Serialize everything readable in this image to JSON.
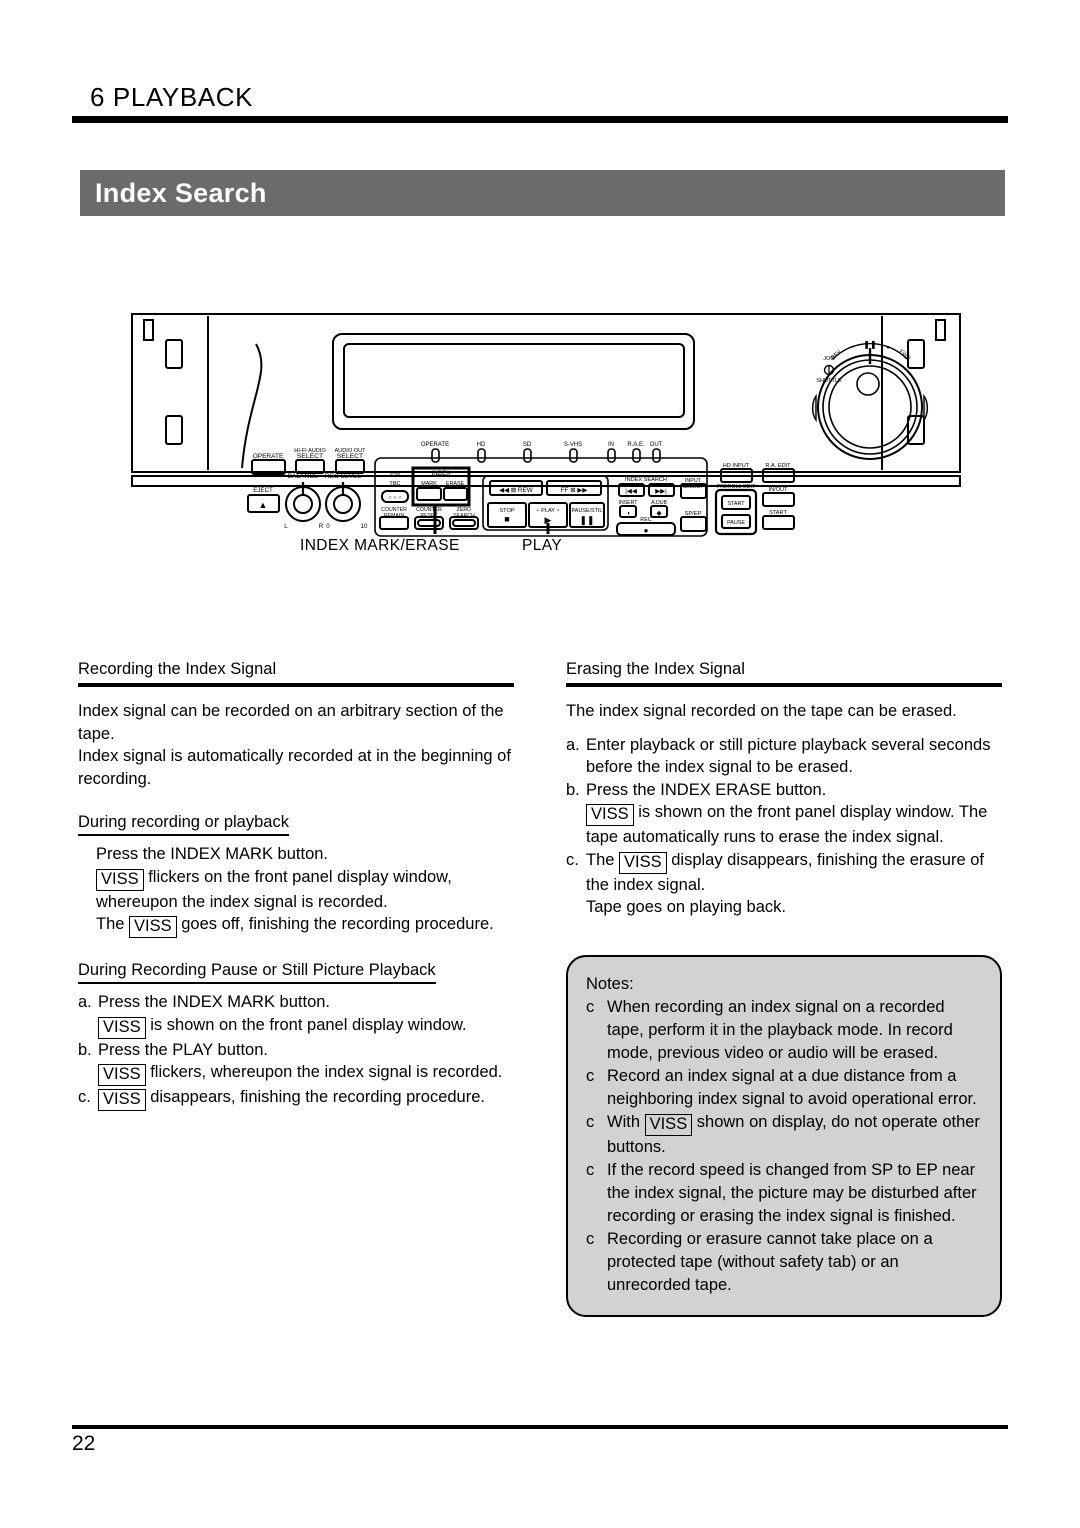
{
  "header": {
    "chapter_title": "6 PLAYBACK"
  },
  "section": {
    "title": "Index Search",
    "banner_color": "#6b6b6b"
  },
  "figure": {
    "name": "vcr-front-panel",
    "callouts": [
      {
        "label": "INDEX MARK/ERASE"
      },
      {
        "label": "PLAY"
      }
    ],
    "panel_labels": {
      "operate_button": "OPERATE",
      "hifi_audio_select": "HI-FI AUDIO",
      "hifi_audio_select2": "SELECT",
      "audio_out_select": "AUDIO OUT",
      "audio_out_select2": "SELECT",
      "eject": "EJECT",
      "balance": "BALANCE",
      "balance_left": "L",
      "balance_right": "R",
      "rec_level": "REC LEVEL",
      "rec_level_min": "0",
      "rec_level_max": "10",
      "s29_tbc": "S29",
      "s29_tbc2": "TBC",
      "index": "INDEX",
      "index_mark": "MARK",
      "index_erase": "ERASE",
      "counter_remain": "COUNTER",
      "counter_remain2": "REMAIN",
      "counter_reset": "COUNTER",
      "counter_reset2": "RESET",
      "zero_search": "ZERO",
      "zero_search2": "SEARCH",
      "rew": "REW",
      "ff": "FF",
      "stop": "STOP",
      "play": "PLAY",
      "pause_still": "PAUSE/STIL",
      "index_search": "INDEX SEARCH",
      "insert": "INSERT",
      "a_dub": "A.DUB",
      "rec": "REC",
      "input_select": "INPUT",
      "input_select2": "SELECT",
      "sp_ep": "SP/EP",
      "hd_input": "HD INPUT",
      "preroll_edit": "PREROLL EDIT",
      "preroll_start": "START",
      "preroll_pause": "PAUSE",
      "ra_edit": "R.A. EDIT",
      "in_out": "IN/OUT",
      "start": "START",
      "jog": "JOG",
      "shuttle": "SHUTTLE",
      "rev": "REV",
      "fwd": "FWD"
    },
    "indicator_labels": [
      "OPERATE",
      "HD",
      "SD",
      "S-VHS",
      "IN",
      "R.A.E.",
      "OUT"
    ]
  },
  "left_column": {
    "heading": "Recording the Index Signal",
    "intro": [
      "Index signal can be recorded on an arbitrary section of the tape.",
      "Index signal is automatically recorded at in the beginning of recording."
    ],
    "subsection1": {
      "heading": "During recording or playback",
      "lines": [
        {
          "parts": [
            {
              "t": "text",
              "v": "Press the INDEX MARK button."
            }
          ]
        },
        {
          "parts": [
            {
              "t": "box",
              "v": "VISS"
            },
            {
              "t": "text",
              "v": " flickers on the front panel display window, whereupon the index signal is recorded."
            }
          ]
        },
        {
          "parts": [
            {
              "t": "text",
              "v": "The "
            },
            {
              "t": "box",
              "v": "VISS"
            },
            {
              "t": "text",
              "v": " goes off, finishing the recording procedure."
            }
          ]
        }
      ]
    },
    "subsection2": {
      "heading": "During Recording Pause or Still Picture Playback",
      "items": [
        {
          "marker": "a.",
          "parts": [
            {
              "t": "text",
              "v": "Press the INDEX MARK button."
            }
          ]
        },
        {
          "marker": "",
          "parts": [
            {
              "t": "box",
              "v": "VISS"
            },
            {
              "t": "text",
              "v": " is shown on the front panel display window."
            }
          ]
        },
        {
          "marker": "b.",
          "parts": [
            {
              "t": "text",
              "v": "Press the PLAY button."
            }
          ]
        },
        {
          "marker": "",
          "parts": [
            {
              "t": "box",
              "v": "VISS"
            },
            {
              "t": "text",
              "v": " flickers, whereupon the index signal is recorded."
            }
          ]
        },
        {
          "marker": "c.",
          "parts": [
            {
              "t": "box",
              "v": "VISS"
            },
            {
              "t": "text",
              "v": " disappears, finishing the recording procedure."
            }
          ]
        }
      ]
    }
  },
  "right_column": {
    "heading": "Erasing the Index Signal",
    "intro": "The index signal recorded on the tape can be erased.",
    "items": [
      {
        "marker": "a.",
        "parts": [
          {
            "t": "text",
            "v": "Enter playback or still picture playback several seconds before the index signal to be erased."
          }
        ]
      },
      {
        "marker": "b.",
        "parts": [
          {
            "t": "text",
            "v": "Press the INDEX ERASE button."
          }
        ]
      },
      {
        "marker": "",
        "parts": [
          {
            "t": "box",
            "v": "VISS"
          },
          {
            "t": "text",
            "v": " is shown on the front panel display window. The tape automatically runs to erase the index signal."
          }
        ]
      },
      {
        "marker": "c.",
        "parts": [
          {
            "t": "text",
            "v": "The "
          },
          {
            "t": "box",
            "v": "VISS"
          },
          {
            "t": "text",
            "v": " display disappears, finishing the erasure of the index signal."
          }
        ]
      },
      {
        "marker": "",
        "parts": [
          {
            "t": "text",
            "v": "Tape goes on playing back."
          }
        ]
      }
    ]
  },
  "notes": {
    "title": "Notes:",
    "bullet_glyph": "c",
    "background_color": "#d2d2d2",
    "items": [
      {
        "parts": [
          {
            "t": "text",
            "v": "When recording an index signal on a recorded tape, perform it in the playback mode.  In record mode, previous video or audio will be erased."
          }
        ]
      },
      {
        "parts": [
          {
            "t": "text",
            "v": "Record an index signal at a due distance from a neighboring index signal to avoid operational error."
          }
        ]
      },
      {
        "parts": [
          {
            "t": "text",
            "v": "With "
          },
          {
            "t": "box",
            "v": "VISS"
          },
          {
            "t": "text",
            "v": " shown on display, do not operate other buttons."
          }
        ]
      },
      {
        "parts": [
          {
            "t": "text",
            "v": "If the record speed is changed from SP to EP near the index signal, the picture may be disturbed after recording or erasing the index signal is finished."
          }
        ]
      },
      {
        "parts": [
          {
            "t": "text",
            "v": "Recording or erasure cannot take place on a protected tape (without safety tab) or an unrecorded tape."
          }
        ]
      }
    ]
  },
  "footer": {
    "page_number": "22"
  }
}
